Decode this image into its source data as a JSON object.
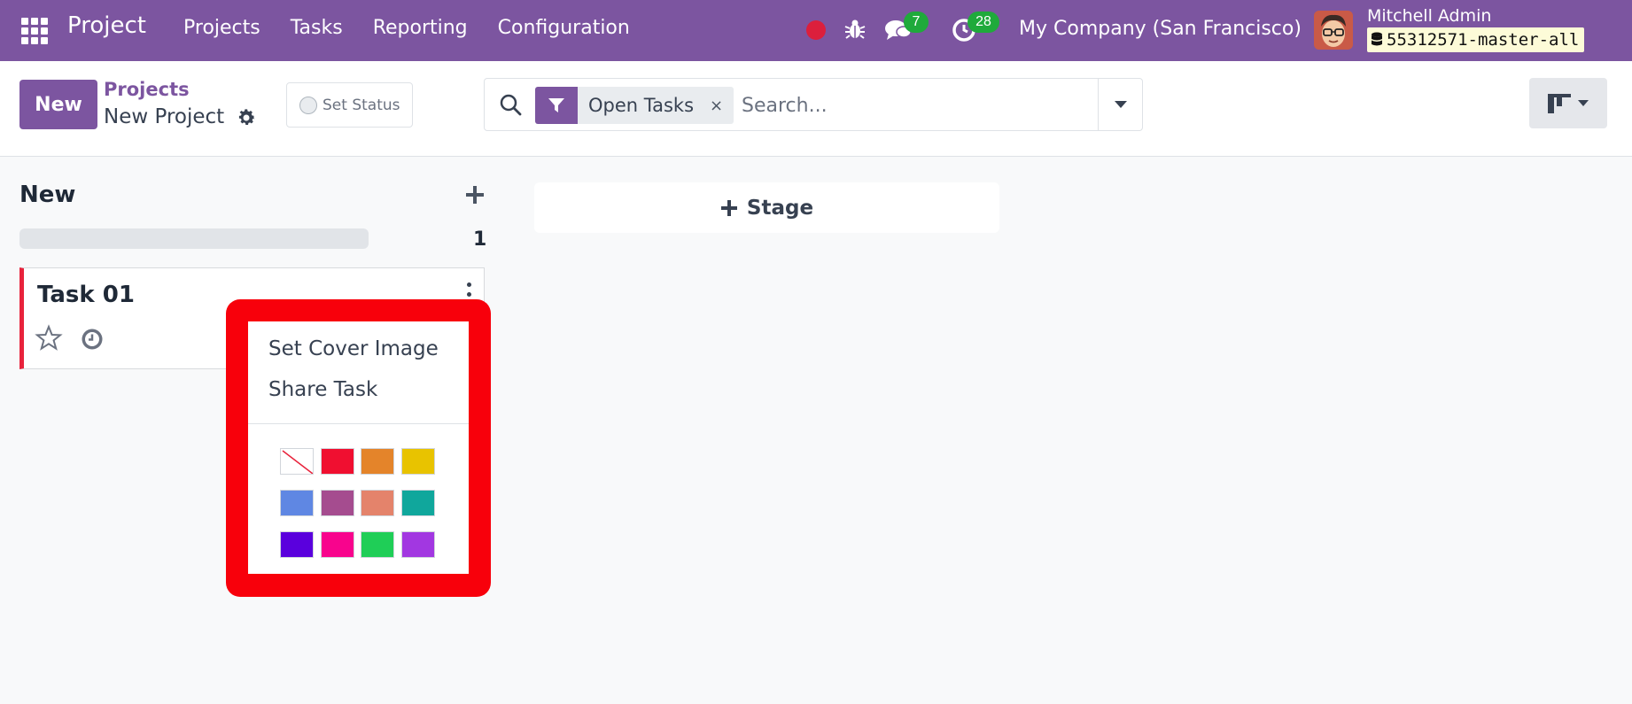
{
  "navbar": {
    "app_title": "Project",
    "menu": [
      "Projects",
      "Tasks",
      "Reporting",
      "Configuration"
    ],
    "messages_count": "7",
    "activities_count": "28",
    "company": "My Company (San Francisco)",
    "user_name": "Mitchell Admin",
    "database": "55312571-master-all"
  },
  "control_panel": {
    "new_label": "New",
    "breadcrumb": "Projects",
    "current": "New Project",
    "set_status": "Set Status",
    "facet_label": "Open Tasks",
    "facet_close": "×",
    "search_placeholder": "Search..."
  },
  "kanban": {
    "column_title": "New",
    "column_count": "1",
    "stage_button": "Stage",
    "card": {
      "title": "Task 01",
      "accent_color": "#e8233c"
    }
  },
  "dropdown": {
    "items": [
      "Set Cover Image",
      "Share Task"
    ],
    "colors": [
      "none",
      "#f00f30",
      "#e4842a",
      "#e8c300",
      "#5f87e3",
      "#a54c8f",
      "#e4836b",
      "#10a79c",
      "#5a00dd",
      "#f8048d",
      "#1fce57",
      "#a237e1"
    ]
  },
  "colors": {
    "brand": "#7c55a0",
    "highlight": "#f8000b"
  }
}
